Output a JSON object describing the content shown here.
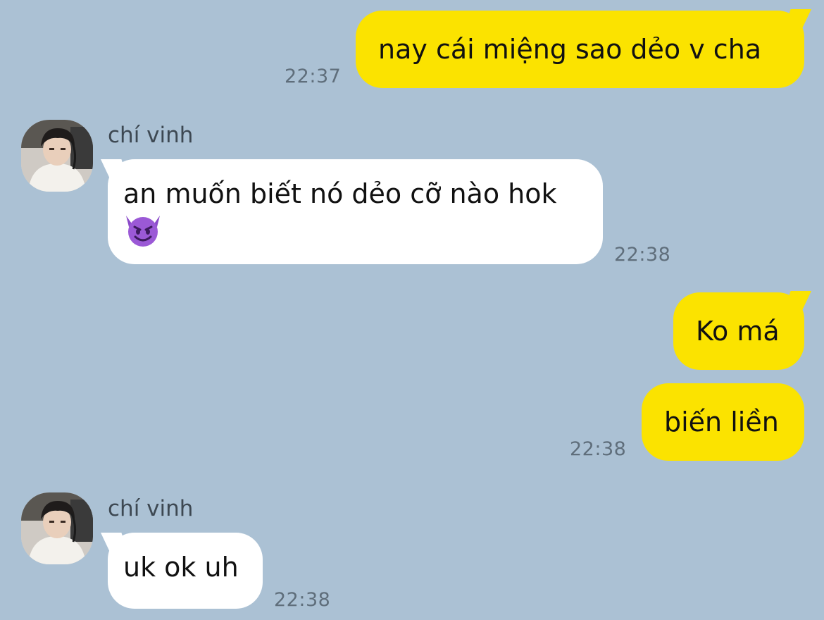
{
  "chat": {
    "colors": {
      "background": "#abc1d4",
      "my_bubble": "#fbe300",
      "their_bubble": "#ffffff",
      "timestamp": "#5f6e7b"
    },
    "messages": [
      {
        "from": "me",
        "text": "nay cái miệng sao dẻo v cha",
        "time": "22:37"
      },
      {
        "from": "them",
        "sender": "chí vinh",
        "text": "an muốn biết nó dẻo cỡ nào hok",
        "emoji_icon": "smiling-devil-emoji",
        "time": "22:38"
      },
      {
        "from": "me",
        "text": "Ko má"
      },
      {
        "from": "me",
        "text": "biến liền",
        "time": "22:38"
      },
      {
        "from": "them",
        "sender": "chí vinh",
        "text": "uk ok uh",
        "time": "22:38"
      }
    ]
  }
}
